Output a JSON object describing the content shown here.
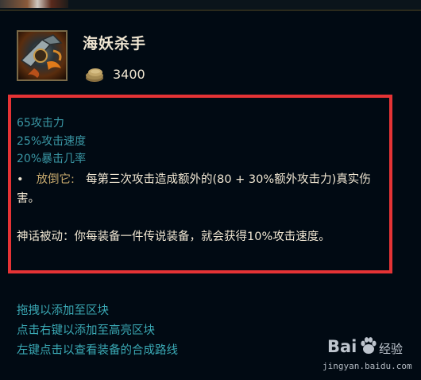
{
  "item": {
    "name": "海妖杀手",
    "gold": "3400",
    "icon": "kraken-slayer-item-icon"
  },
  "stats": [
    "65攻击力",
    "25%攻击速度",
    "20%暴击几率"
  ],
  "passive": {
    "bullet": "•",
    "name": "放倒它:",
    "description": "每第三次攻击造成额外的(80 + 30%额外攻击力)真实伤害。"
  },
  "mythic_passive": "神话被动：你每装备一件传说装备，就会获得10%攻击速度。",
  "hints": [
    "拖拽以添加至区块",
    "点击右键以添加至高亮区块",
    "左键点击以查看装备的合成路线"
  ],
  "watermark": {
    "logo": "Bai",
    "paw_icon": "baidu-paw-icon",
    "label": "经验",
    "url": "jingyan.baidu.com"
  },
  "colors": {
    "background": "#010a13",
    "title": "#f0e6d2",
    "stat": "#3a98a6",
    "passive_name": "#c8aa6e",
    "hint": "#3aa9b5",
    "highlight": "#e53335"
  }
}
